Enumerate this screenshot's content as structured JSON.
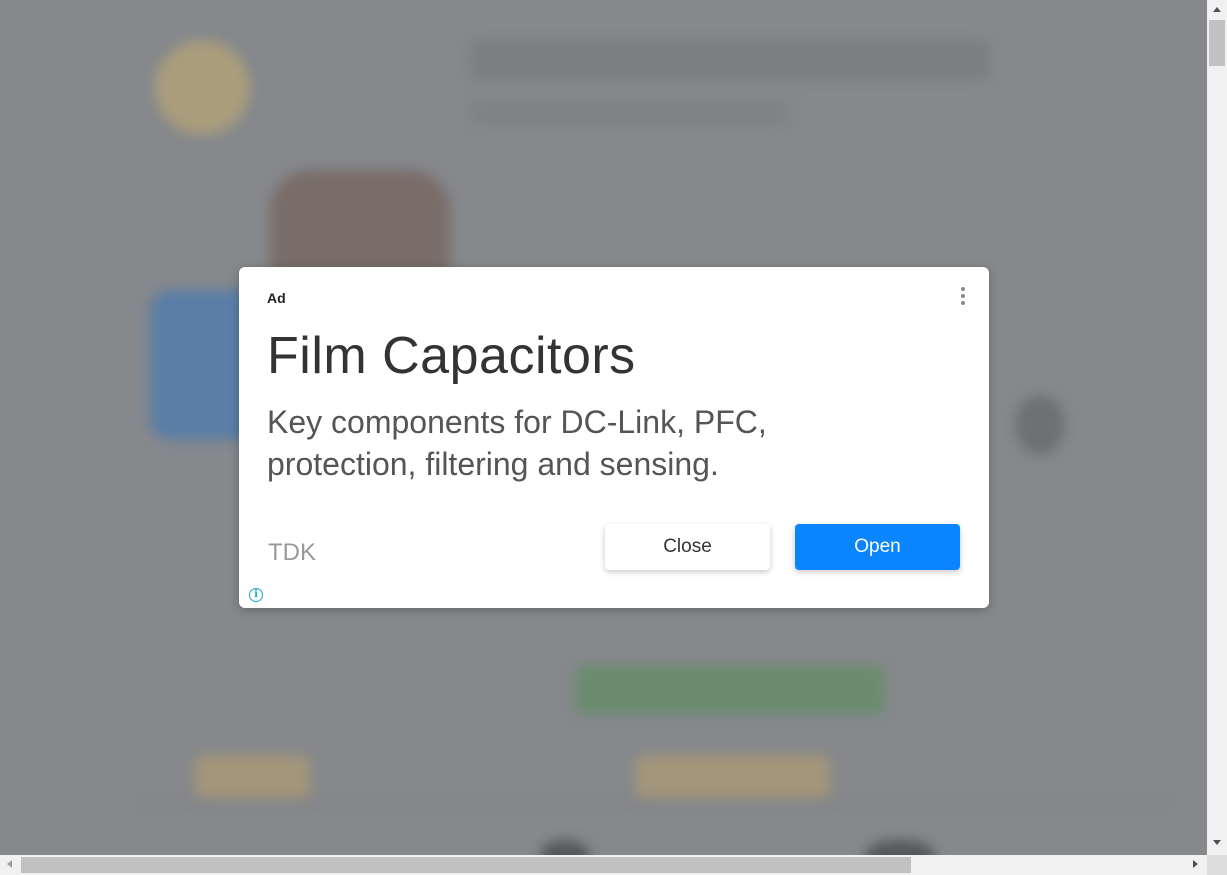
{
  "ad": {
    "label": "Ad",
    "title": "Film Capacitors",
    "body": "Key components for DC-Link, PFC, protection, filtering and sensing.",
    "advertiser": "TDK",
    "close_label": "Close",
    "open_label": "Open",
    "info_glyph": "i",
    "more_icon": "more-vert-icon",
    "info_icon": "info-icon",
    "colors": {
      "open_button": "#0a84ff",
      "info_icon": "#1ea7c8",
      "backdrop": "#8a8c90"
    }
  }
}
